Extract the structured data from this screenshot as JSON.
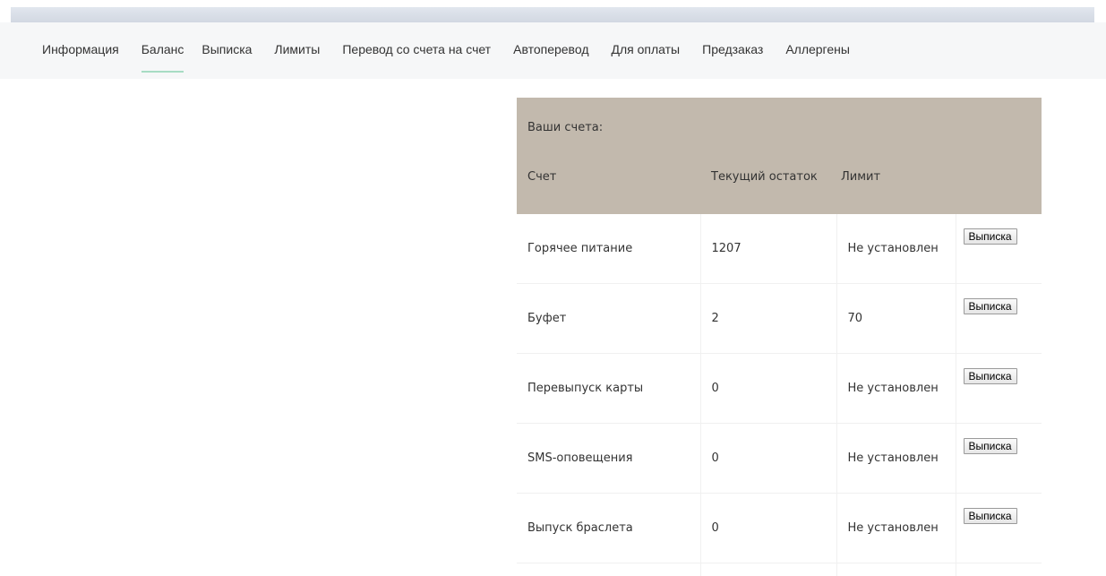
{
  "nav": {
    "items": [
      {
        "label": "Информация"
      },
      {
        "label": "Баланс"
      },
      {
        "label": "Выписка"
      },
      {
        "label": "Лимиты"
      },
      {
        "label": "Перевод со счета на счет"
      },
      {
        "label": "Автоперевод"
      },
      {
        "label": "Для оплаты"
      },
      {
        "label": "Предзаказ"
      },
      {
        "label": "Аллергены"
      }
    ],
    "active_index": 1,
    "active_color": "#a8dcc4"
  },
  "accounts": {
    "caption": "Ваши счета:",
    "headers": {
      "account": "Счет",
      "balance": "Текущий остаток",
      "limit": "Лимит"
    },
    "header_bg": "#c2b9ad",
    "rows": [
      {
        "name": "Горячее питание",
        "balance": "1207",
        "limit": "Не установлен",
        "button": "Выписка"
      },
      {
        "name": "Буфет",
        "balance": "2",
        "limit": "70",
        "button": "Выписка"
      },
      {
        "name": "Перевыпуск карты",
        "balance": "0",
        "limit": "Не установлен",
        "button": "Выписка"
      },
      {
        "name": "SMS-оповещения",
        "balance": "0",
        "limit": "Не установлен",
        "button": "Выписка"
      },
      {
        "name": "Выпуск браслета",
        "balance": "0",
        "limit": "Не установлен",
        "button": "Выписка"
      }
    ]
  }
}
